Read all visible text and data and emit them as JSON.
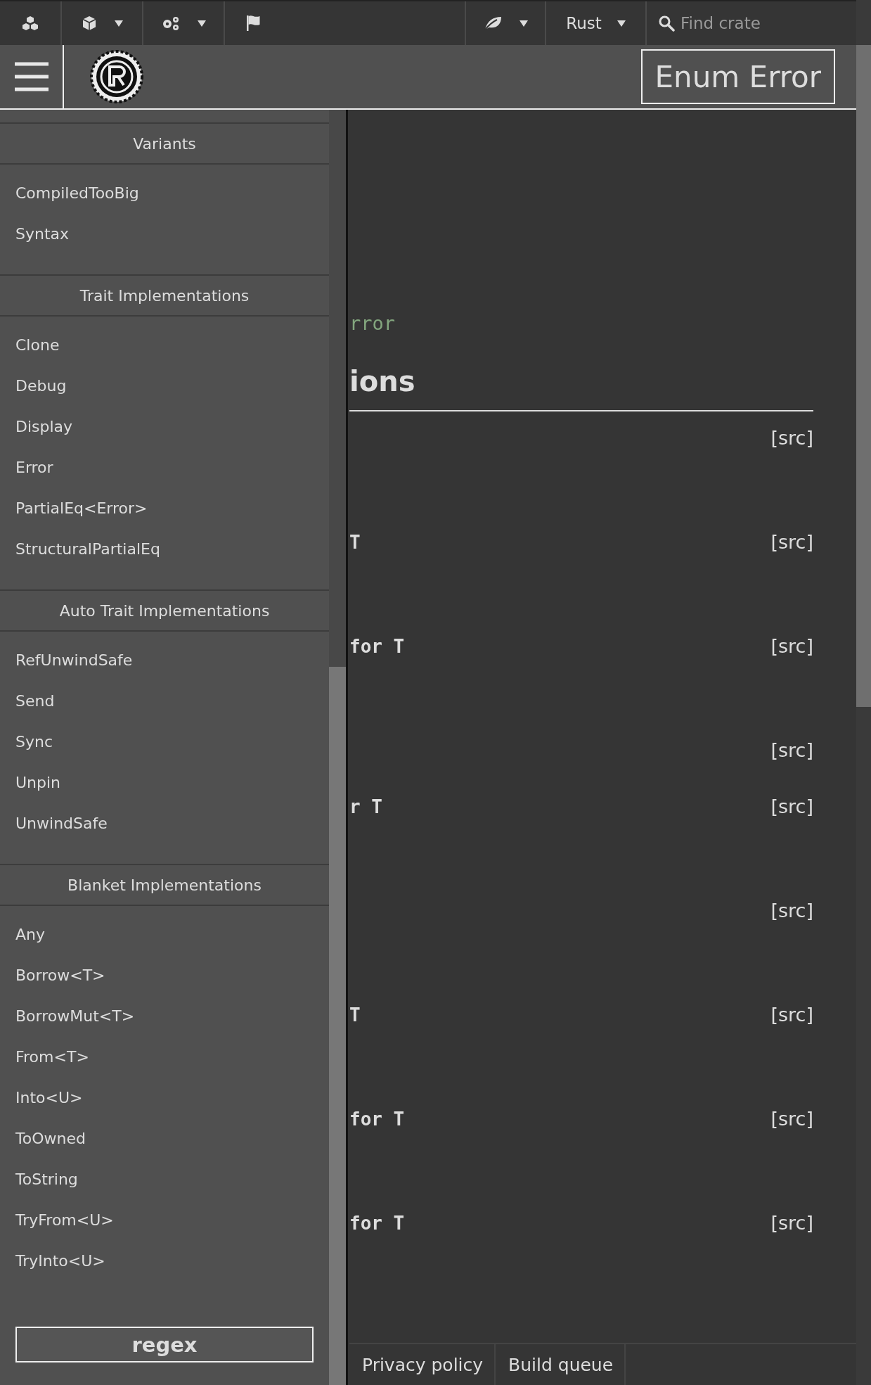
{
  "top_nav": {
    "version_menu": "Rust",
    "search": {
      "placeholder": "Find crate"
    }
  },
  "header": {
    "title": "Enum Error"
  },
  "sidebar": {
    "sections": [
      {
        "title": "Variants",
        "items": [
          "CompiledTooBig",
          "Syntax"
        ]
      },
      {
        "title": "Trait Implementations",
        "items": [
          "Clone",
          "Debug",
          "Display",
          "Error",
          "PartialEq<Error>",
          "StructuralPartialEq"
        ]
      },
      {
        "title": "Auto Trait Implementations",
        "items": [
          "RefUnwindSafe",
          "Send",
          "Sync",
          "Unpin",
          "UnwindSafe"
        ]
      },
      {
        "title": "Blanket Implementations",
        "items": [
          "Any",
          "Borrow<T>",
          "BorrowMut<T>",
          "From<T>",
          "Into<U>",
          "ToOwned",
          "ToString",
          "TryFrom<U>",
          "TryInto<U>"
        ]
      }
    ],
    "crate_button": "regex"
  },
  "content": {
    "type_line": "rror",
    "section_heading": "ions",
    "impl_rows": [
      {
        "src": "[src]"
      },
      {
        "code": "T",
        "src": "[src]"
      },
      {
        "code": "for T",
        "src": "[src]"
      },
      {
        "src": "[src]"
      },
      {
        "code": "r T",
        "src": "[src]"
      },
      {
        "src": "[src]"
      },
      {
        "code": "T",
        "src": "[src]"
      },
      {
        "code": "for T",
        "src": "[src]"
      },
      {
        "code": "for T",
        "src": "[src]"
      }
    ]
  },
  "footer": {
    "links": [
      "Privacy policy",
      "Build queue"
    ]
  }
}
